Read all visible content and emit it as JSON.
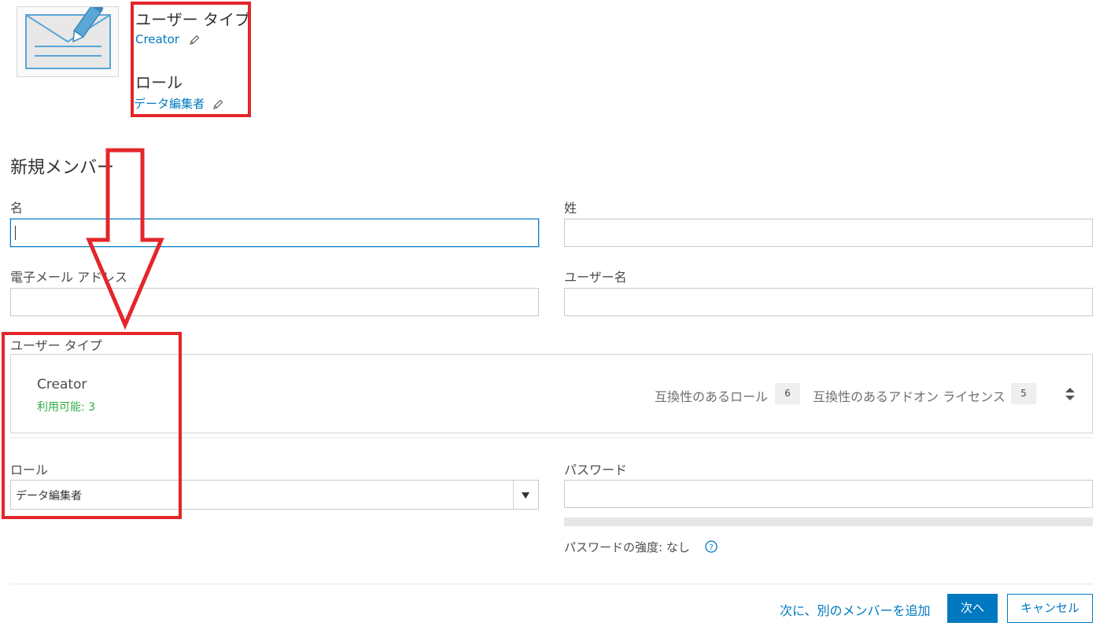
{
  "summary": {
    "user_type_heading": "ユーザー タイプ",
    "user_type_value": "Creator",
    "role_heading": "ロール",
    "role_value": "データ編集者"
  },
  "section_title": "新規メンバー",
  "form": {
    "first_name_label": "名",
    "first_name_value": "",
    "last_name_label": "姓",
    "last_name_value": "",
    "email_label": "電子メール アドレス",
    "email_value": "",
    "username_label": "ユーザー名",
    "username_value": "",
    "user_type_label": "ユーザー タイプ",
    "user_type_card": {
      "name": "Creator",
      "availability": "利用可能: 3",
      "compatible_roles_label": "互換性のあるロール",
      "compatible_roles_count": "6",
      "compatible_addons_label": "互換性のあるアドオン ライセンス",
      "compatible_addons_count": "5"
    },
    "role_label": "ロール",
    "role_selected": "データ編集者",
    "password_label": "パスワード",
    "password_value": "",
    "password_strength": "パスワードの強度: なし"
  },
  "footer": {
    "next_add_another": "次に、別のメンバーを追加",
    "next": "次へ",
    "cancel": "キャンセル"
  },
  "colors": {
    "accent": "#0079c1",
    "annotation_red": "#e3262a",
    "available_green": "#35ac46"
  },
  "icons": {
    "avatar": "envelope-pencil-icon",
    "edit": "pencil-icon",
    "sort": "sort-arrows-icon",
    "dropdown": "triangle-down-icon",
    "help": "help-circle-icon"
  }
}
